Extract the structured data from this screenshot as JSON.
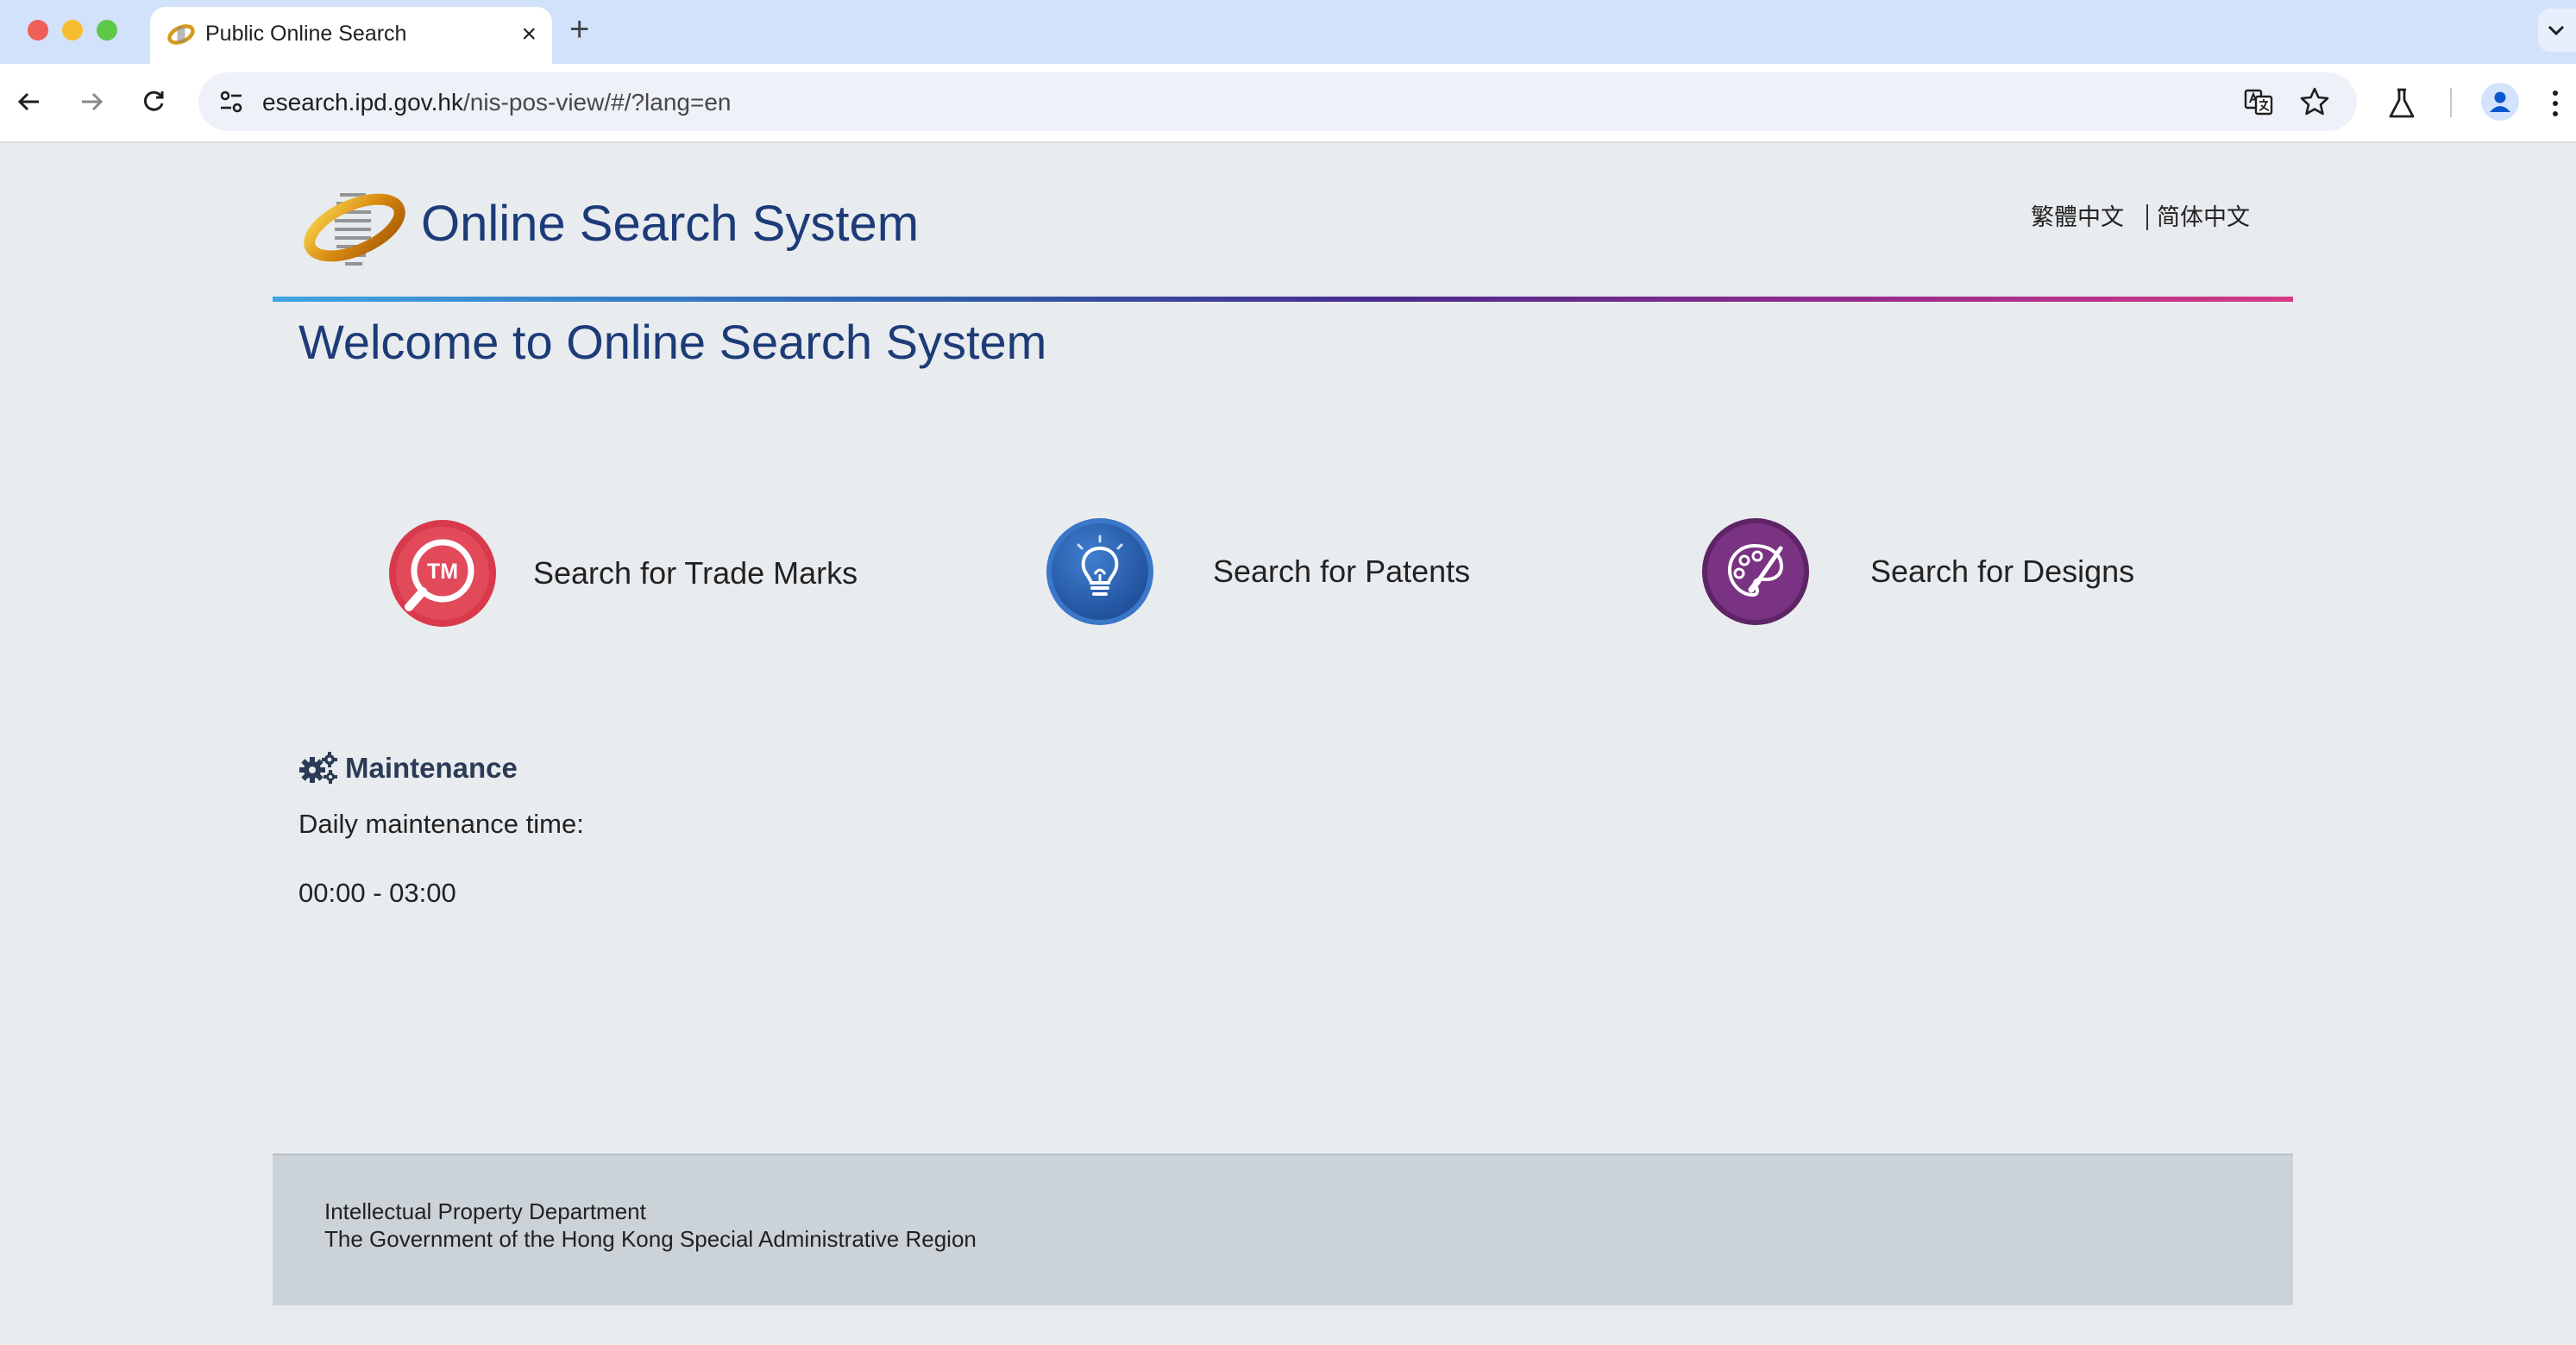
{
  "browser": {
    "tab": {
      "title": "Public Online Search",
      "close": "×"
    },
    "new_tab": "+",
    "address": {
      "host": "esearch.ipd.gov.hk",
      "path": "/nis-pos-view/#/?lang=en"
    }
  },
  "header": {
    "title": "Online Search System",
    "languages": [
      "繁體中文",
      "简体中文"
    ]
  },
  "welcome": "Welcome to Online Search System",
  "search_options": [
    {
      "label": "Search for Trade Marks",
      "icon": "trademark-search-icon",
      "color": "#d83a4c",
      "badge": "TM"
    },
    {
      "label": "Search for Patents",
      "icon": "lightbulb-icon",
      "color": "#2f67b8"
    },
    {
      "label": "Search for Designs",
      "icon": "palette-icon",
      "color": "#6b2a73"
    }
  ],
  "maintenance": {
    "title": "Maintenance",
    "description": "Daily maintenance time:",
    "time": "00:00 - 03:00"
  },
  "footer": {
    "line1": "Intellectual Property Department",
    "line2": "The Government of the Hong Kong Special Administrative Region"
  }
}
